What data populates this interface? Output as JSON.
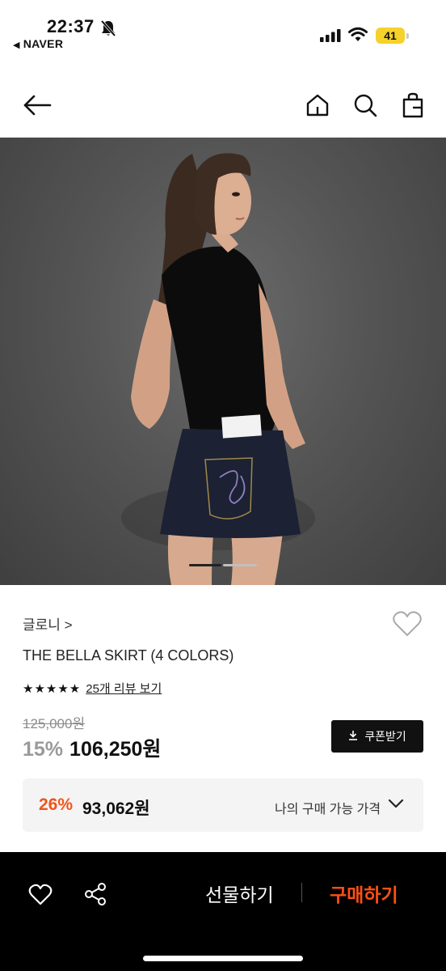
{
  "status_bar": {
    "time": "22:37",
    "back_app": "NAVER",
    "battery": "41",
    "icons": [
      "bell-slash-icon",
      "signal-icon",
      "wifi-icon",
      "battery-icon"
    ]
  },
  "header": {
    "icons": [
      "back-arrow-icon",
      "home-icon",
      "search-icon",
      "shopping-bag-icon"
    ]
  },
  "hero": {
    "image_page": 1,
    "image_count": 2
  },
  "product": {
    "brand": "글로니 >",
    "title": "THE BELLA SKIRT (4 COLORS)",
    "stars": "★★★★★",
    "review_link": "25개 리뷰 보기",
    "original_price": "125,000원",
    "discount": "15%",
    "price": "106,250원",
    "coupon_label": "쿠폰받기"
  },
  "my_price": {
    "discount": "26%",
    "price": "93,062원",
    "label": "나의 구매 가능 가격"
  },
  "bottom_bar": {
    "gift_label": "선물하기",
    "buy_label": "구매하기"
  },
  "colors": {
    "accent_orange": "#ff4f14",
    "discount_orange": "#f2541b",
    "battery_yellow": "#f5d12c",
    "bottom_bar_bg": "#000000"
  }
}
